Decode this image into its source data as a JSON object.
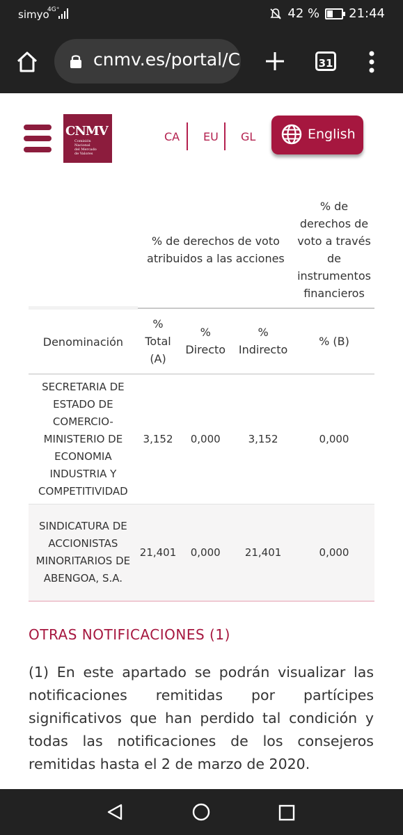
{
  "status_bar": {
    "carrier": "simyo",
    "network": "4G⁺",
    "battery_text": "42 %",
    "battery_level": 0.42,
    "time": "21:44"
  },
  "browser": {
    "url": "cnmv.es/portal/C",
    "tab_count": "31"
  },
  "header": {
    "logo_text": "CNMV",
    "logo_subtext": "Comisión\nNacional\ndel Mercado\nde Valores",
    "languages": [
      "CA",
      "EU",
      "GL"
    ],
    "english_label": "English"
  },
  "table": {
    "group_header": "% de derechos de voto atribuidos a las acciones",
    "via_header": "% de derechos de voto a través de instrumentos financieros",
    "columns": [
      "Denominación",
      "% Total (A)",
      "% Directo",
      "% Indirecto",
      "% (B)"
    ],
    "rows": [
      {
        "name": "SECRETARIA DE ESTADO DE COMERCIO-MINISTERIO DE ECONOMIA INDUSTRIA Y COMPETITIVIDAD",
        "total": "3,152",
        "directo": "0,000",
        "indirecto": "3,152",
        "b": "0,000"
      },
      {
        "name": "SINDICATURA DE ACCIONISTAS MINORITARIOS DE ABENGOA, S.A.",
        "total": "21,401",
        "directo": "0,000",
        "indirecto": "21,401",
        "b": "0,000"
      }
    ]
  },
  "otras": {
    "title": "OTRAS NOTIFICACIONES (1)",
    "note": "(1) En este apartado se podrán visualizar las notificaciones remitidas por partícipes significativos que han perdido tal condición y todas las notificaciones de los consejeros remitidas hasta el 2 de marzo de 2020."
  },
  "colors": {
    "brand": "#a6173f",
    "system_bar": "#222222"
  }
}
